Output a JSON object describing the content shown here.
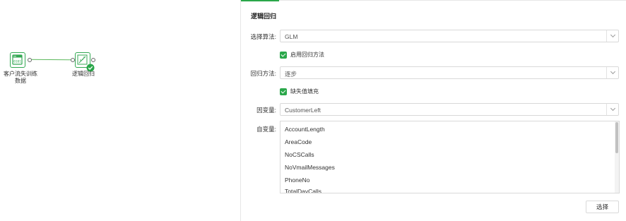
{
  "canvas": {
    "nodes": [
      {
        "label_line1": "客户流失训练",
        "label_line2": "数据",
        "icon": "dataset-icon"
      },
      {
        "label_line1": "逻辑回归",
        "icon": "regression-icon",
        "status": "success-check-icon"
      }
    ]
  },
  "panel": {
    "title": "逻辑回归",
    "algorithm": {
      "label": "选择算法:",
      "value": "GLM"
    },
    "enable_regression_method": {
      "label": "启用回归方法",
      "checked": true
    },
    "regression_method": {
      "label": "回归方法:",
      "value": "逐步"
    },
    "fill_missing": {
      "label": "缺失值填充",
      "checked": true
    },
    "dependent_variable": {
      "label": "因变量:",
      "value": "CustomerLeft"
    },
    "independent_variables": {
      "label": "自变量:",
      "items": [
        "AccountLength",
        "AreaCode",
        "NoCSCalls",
        "NoVmailMessages",
        "PhoneNo",
        "TotalDayCalls"
      ]
    },
    "choose_button": "选择"
  },
  "colors": {
    "accent": "#2aa74a",
    "border": "#d9d9d9"
  }
}
